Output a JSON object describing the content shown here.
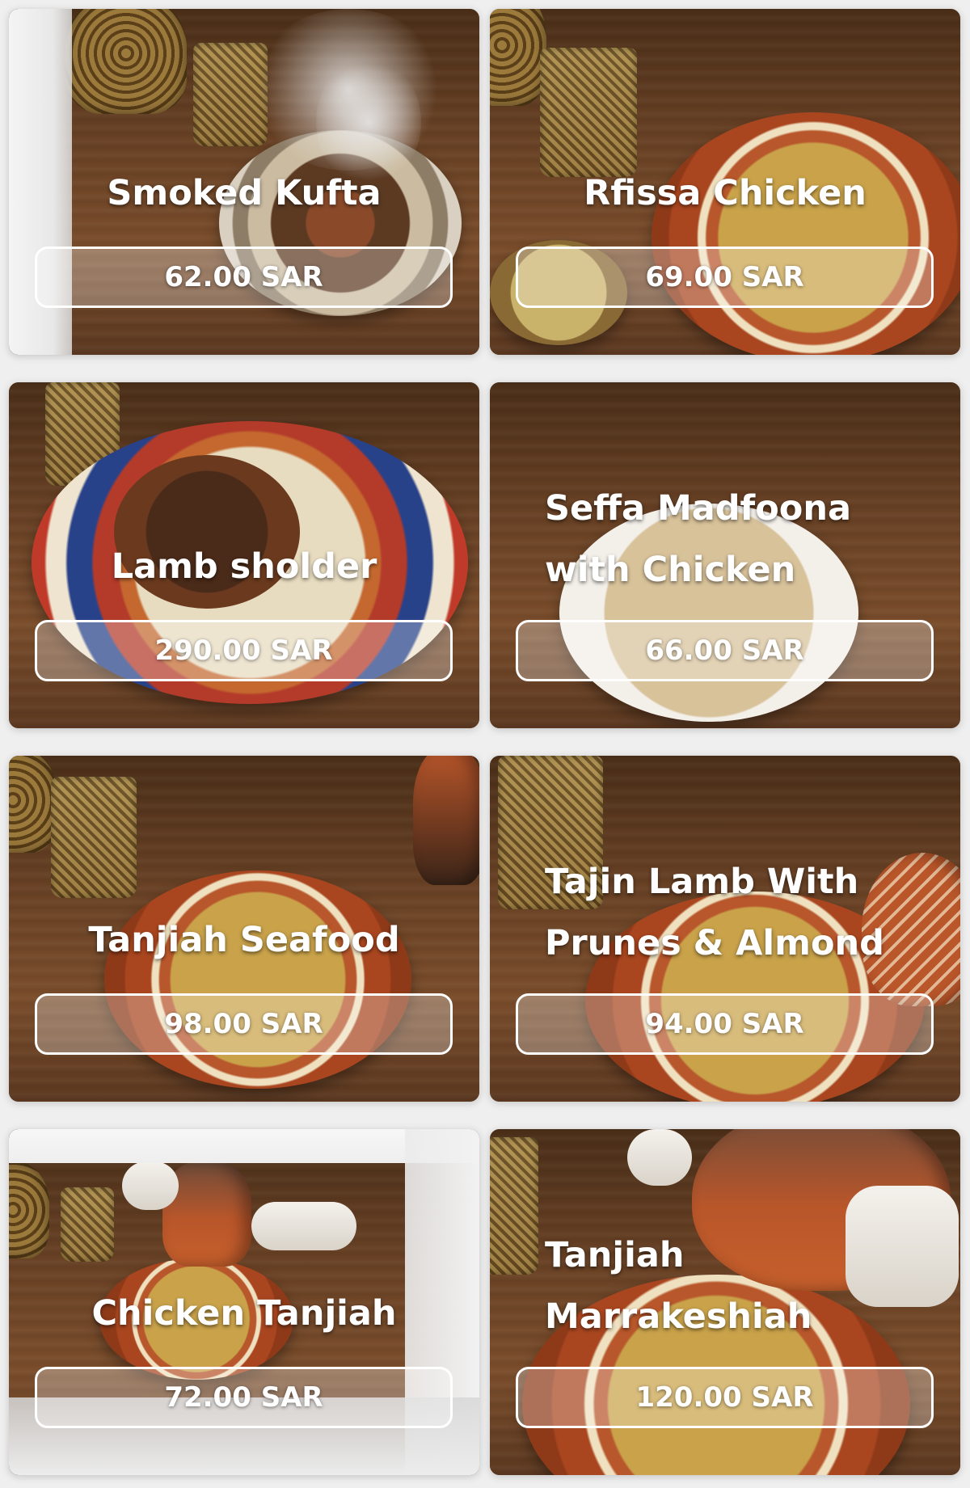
{
  "menu": {
    "currency": "SAR",
    "items": [
      {
        "name": "Smoked Kufta",
        "price": "62.00 SAR"
      },
      {
        "name": "Rfissa Chicken",
        "price": "69.00 SAR"
      },
      {
        "name": "Lamb sholder",
        "price": "290.00 SAR"
      },
      {
        "name_line1": "Seffa Madfoona",
        "name_line2": "with Chicken",
        "price": "66.00 SAR"
      },
      {
        "name": "Tanjiah Seafood",
        "price": "98.00 SAR"
      },
      {
        "name_line1": "Tajin Lamb With",
        "name_line2": "Prunes & Almond",
        "price": "94.00 SAR"
      },
      {
        "name": "Chicken Tanjiah",
        "price": "72.00 SAR"
      },
      {
        "name_line1": "Tanjiah",
        "name_line2": "Marrakeshiah",
        "price": "120.00 SAR"
      }
    ]
  },
  "theme": {
    "page_background": "#efefef",
    "button_border": "#ffffff",
    "text_color": "#ffffff"
  }
}
